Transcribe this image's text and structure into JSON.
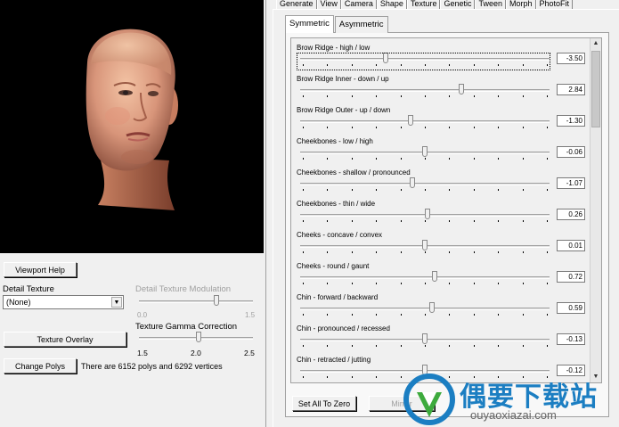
{
  "left": {
    "viewport_help": "Viewport Help",
    "detail_texture_label": "Detail Texture",
    "detail_texture_value": "(None)",
    "modulation_label": "Detail Texture Modulation",
    "modulation_min": "0.0",
    "modulation_max": "1.5",
    "texture_overlay": "Texture Overlay",
    "gamma_label": "Texture Gamma Correction",
    "gamma_min": "1.5",
    "gamma_mid": "2.0",
    "gamma_max": "2.5",
    "change_polys": "Change Polys",
    "poly_info": "There are 6152 polys and 6292 vertices"
  },
  "tabs": [
    "Generate",
    "View",
    "Camera",
    "Shape",
    "Texture",
    "Genetic",
    "Tween",
    "Morph",
    "PhotoFit"
  ],
  "active_tab": "Shape",
  "subtabs": [
    "Symmetric",
    "Asymmetric"
  ],
  "shapes": [
    {
      "name": "Brow Ridge - high / low",
      "value": "-3.50",
      "level": 0.34
    },
    {
      "name": "Brow Ridge Inner - down / up",
      "value": "2.84",
      "level": 0.65
    },
    {
      "name": "Brow Ridge Outer - up / down",
      "value": "-1.30",
      "level": 0.44
    },
    {
      "name": "Cheekbones - low / high",
      "value": "-0.06",
      "level": 0.5
    },
    {
      "name": "Cheekbones - shallow / pronounced",
      "value": "-1.07",
      "level": 0.45
    },
    {
      "name": "Cheekbones - thin / wide",
      "value": "0.26",
      "level": 0.51
    },
    {
      "name": "Cheeks - concave / convex",
      "value": "0.01",
      "level": 0.5
    },
    {
      "name": "Cheeks - round / gaunt",
      "value": "0.72",
      "level": 0.54
    },
    {
      "name": "Chin - forward / backward",
      "value": "0.59",
      "level": 0.53
    },
    {
      "name": "Chin - pronounced / recessed",
      "value": "-0.13",
      "level": 0.5
    },
    {
      "name": "Chin - retracted / jutting",
      "value": "-0.12",
      "level": 0.5
    }
  ],
  "buttons": {
    "set_all_zero": "Set All To Zero",
    "mirror": "Mirror"
  },
  "watermark": {
    "title": "偶要下载站",
    "url": "ouyaoxiazai.com"
  }
}
